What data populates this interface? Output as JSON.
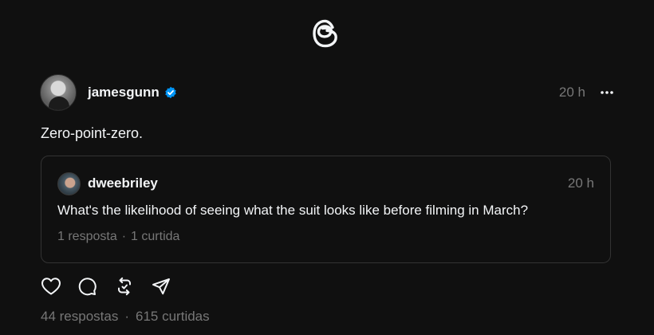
{
  "app": {
    "logo": "threads-logo"
  },
  "post": {
    "username": "jamesgunn",
    "verified": true,
    "time": "20 h",
    "text": "Zero-point-zero.",
    "replies": "44 respostas",
    "separator": "·",
    "likes": "615 curtidas"
  },
  "quote": {
    "username": "dweebriley",
    "time": "20 h",
    "text": "What's the likelihood of seeing what the suit looks like before filming in March?",
    "replies": "1 resposta",
    "separator": "·",
    "likes": "1 curtida"
  },
  "icons": {
    "more": "more-horizontal-icon",
    "like": "heart-icon",
    "reply": "comment-icon",
    "repost": "repost-icon",
    "share": "send-icon"
  },
  "colors": {
    "background": "#101010",
    "text": "#f3f5f7",
    "muted": "#777777",
    "border": "#333333",
    "verified": "#0095f6"
  }
}
